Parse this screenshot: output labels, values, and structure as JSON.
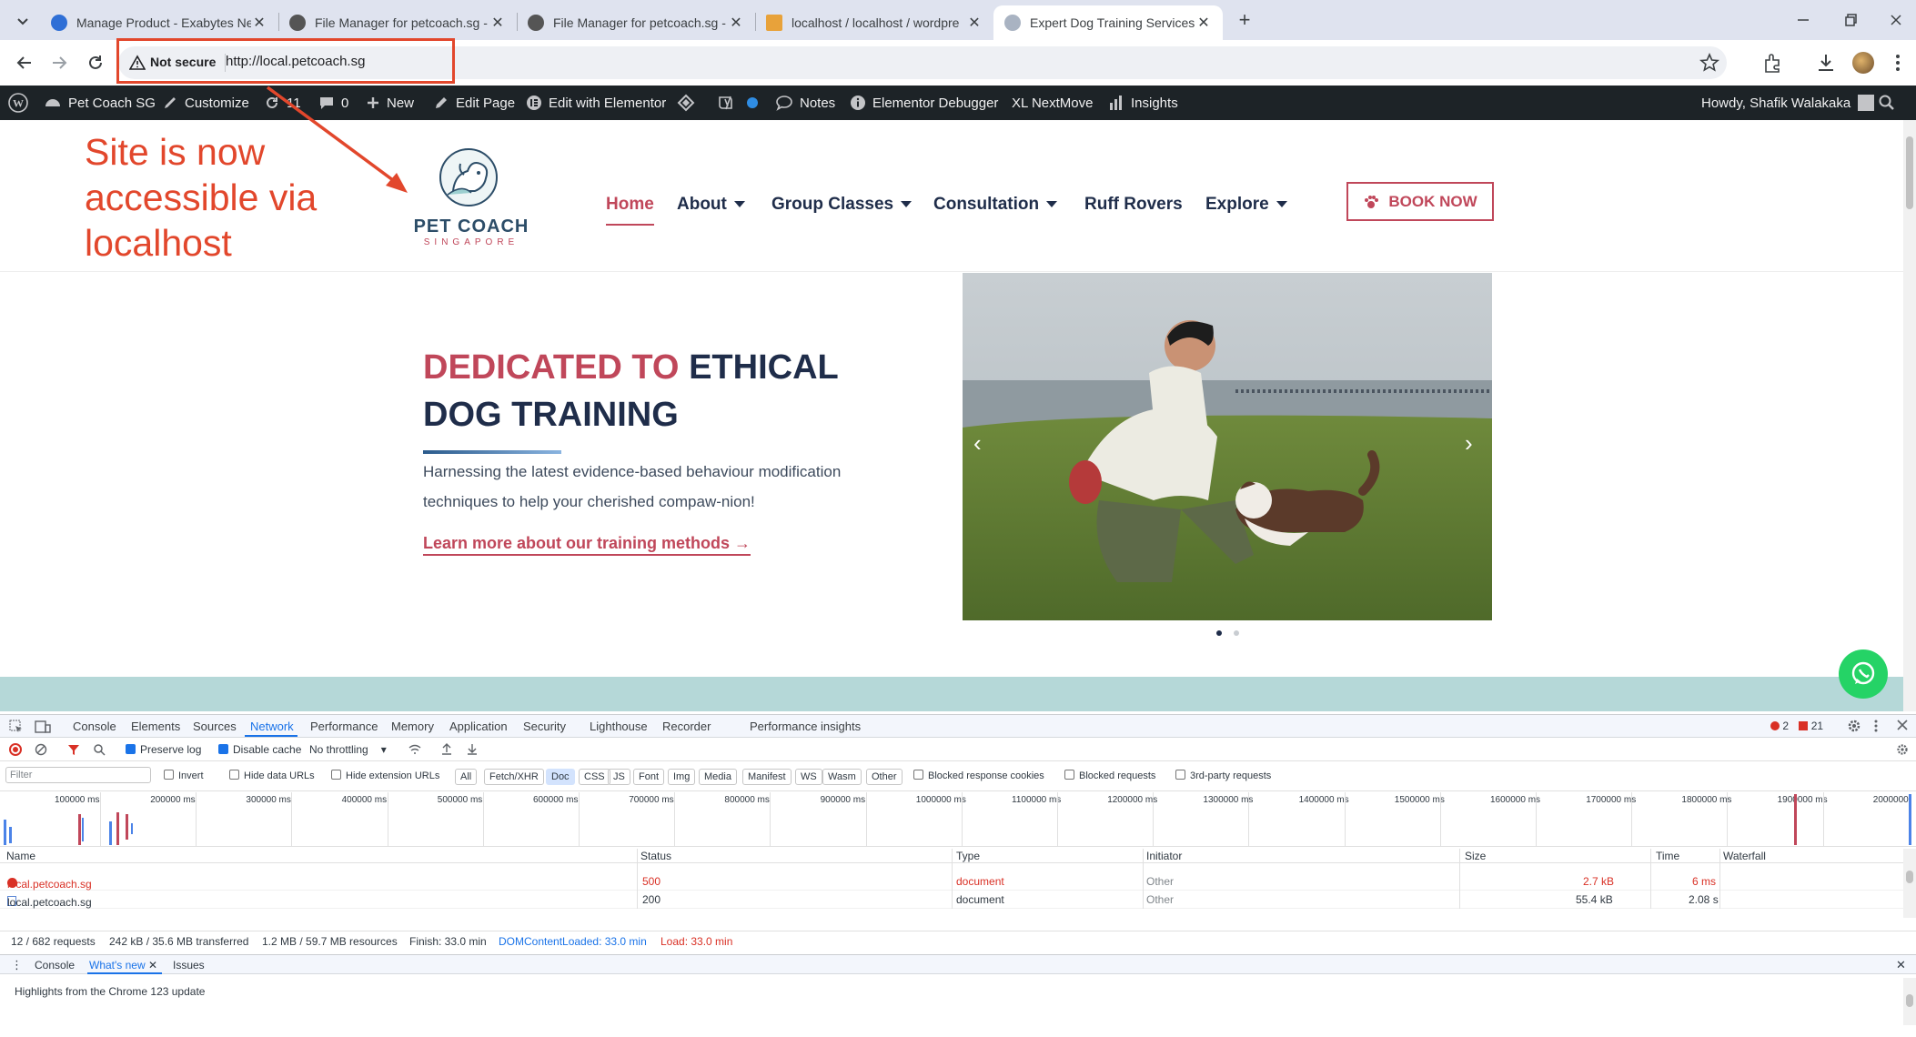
{
  "browser": {
    "tabs": [
      {
        "title": "Manage Product - Exabytes Net",
        "active": false
      },
      {
        "title": "File Manager for petcoach.sg -",
        "active": false
      },
      {
        "title": "File Manager for petcoach.sg -",
        "active": false
      },
      {
        "title": "localhost / localhost / wordpre",
        "active": false
      },
      {
        "title": "Expert Dog Training Services @",
        "active": true
      }
    ],
    "new_tab": "+",
    "security_label": "Not secure",
    "url": "http://local.petcoach.sg"
  },
  "annotation": {
    "line1": "Site is now",
    "line2": "accessible via",
    "line3": "localhost",
    "color": "#e2472c"
  },
  "wpbar": {
    "site_name": "Pet Coach SG",
    "customize": "Customize",
    "updates_count": "11",
    "comments_count": "0",
    "new": "New",
    "edit_page": "Edit Page",
    "edit_elementor": "Edit with Elementor",
    "notes": "Notes",
    "debugger": "Elementor Debugger",
    "nextmove": "XL NextMove",
    "insights": "Insights",
    "howdy": "Howdy, Shafik Walakaka"
  },
  "site": {
    "logo_line1": "PET COACH",
    "logo_line2": "SINGAPORE",
    "nav": [
      {
        "label": "Home",
        "active": true,
        "dropdown": false
      },
      {
        "label": "About",
        "active": false,
        "dropdown": true
      },
      {
        "label": "Group Classes",
        "active": false,
        "dropdown": true
      },
      {
        "label": "Consultation",
        "active": false,
        "dropdown": true
      },
      {
        "label": "Ruff Rovers",
        "active": false,
        "dropdown": false
      },
      {
        "label": "Explore",
        "active": false,
        "dropdown": true
      }
    ],
    "book_now": "BOOK NOW",
    "hero": {
      "title_part1": "DEDICATED TO",
      "title_part2": "ETHICAL",
      "title_line2": "DOG TRAINING",
      "description_line1": "Harnessing the latest evidence-based behaviour modification",
      "description_line2": "techniques to help your cherished compaw-nion!",
      "link": "Learn more about our training methods →"
    },
    "slider_dots": 2,
    "colors": {
      "brand_red": "#c0475a",
      "brand_navy": "#1f2d4a",
      "accent_teal": "#b5d8d8",
      "whatsapp": "#25d366"
    }
  },
  "devtools": {
    "tabs": [
      "Console",
      "Elements",
      "Sources",
      "Network",
      "Performance",
      "Memory",
      "Application",
      "Security",
      "Lighthouse",
      "Recorder",
      "Performance insights"
    ],
    "active_tab": "Network",
    "errors": "2",
    "warnings": "21",
    "preserve_log": "Preserve log",
    "disable_cache": "Disable cache",
    "throttling": "No throttling",
    "filter_placeholder": "Filter",
    "invert": "Invert",
    "hide_data": "Hide data URLs",
    "hide_ext": "Hide extension URLs",
    "chips": [
      "All",
      "Fetch/XHR",
      "Doc",
      "CSS",
      "JS",
      "Font",
      "Img",
      "Media",
      "Manifest",
      "WS",
      "Wasm",
      "Other"
    ],
    "active_chip": "Doc",
    "blocked_cookies": "Blocked response cookies",
    "blocked_requests": "Blocked requests",
    "third_party": "3rd-party requests",
    "timeline_ticks": [
      "100000 ms",
      "200000 ms",
      "300000 ms",
      "400000 ms",
      "500000 ms",
      "600000 ms",
      "700000 ms",
      "800000 ms",
      "900000 ms",
      "1000000 ms",
      "1100000 ms",
      "1200000 ms",
      "1300000 ms",
      "1400000 ms",
      "1500000 ms",
      "1600000 ms",
      "1700000 ms",
      "1800000 ms",
      "1900000 ms",
      "2000000"
    ],
    "columns": [
      "Name",
      "Status",
      "Type",
      "Initiator",
      "Size",
      "Time",
      "Waterfall"
    ],
    "rows": [
      {
        "name": "local.petcoach.sg",
        "status": "500",
        "type": "document",
        "initiator": "Other",
        "size": "2.7 kB",
        "time": "6 ms",
        "error": true
      },
      {
        "name": "local.petcoach.sg",
        "status": "200",
        "type": "document",
        "initiator": "Other",
        "size": "55.4 kB",
        "time": "2.08 s",
        "error": false
      }
    ],
    "summary": {
      "requests": "12 / 682 requests",
      "transferred": "242 kB / 35.6 MB transferred",
      "resources": "1.2 MB / 59.7 MB resources",
      "finish": "Finish: 33.0 min",
      "dcl": "DOMContentLoaded: 33.0 min",
      "load": "Load: 33.0 min"
    },
    "drawer_tabs": [
      "Console",
      "What's new",
      "Issues"
    ],
    "drawer_active": "What's new",
    "drawer_text": "Highlights from the Chrome 123 update"
  }
}
